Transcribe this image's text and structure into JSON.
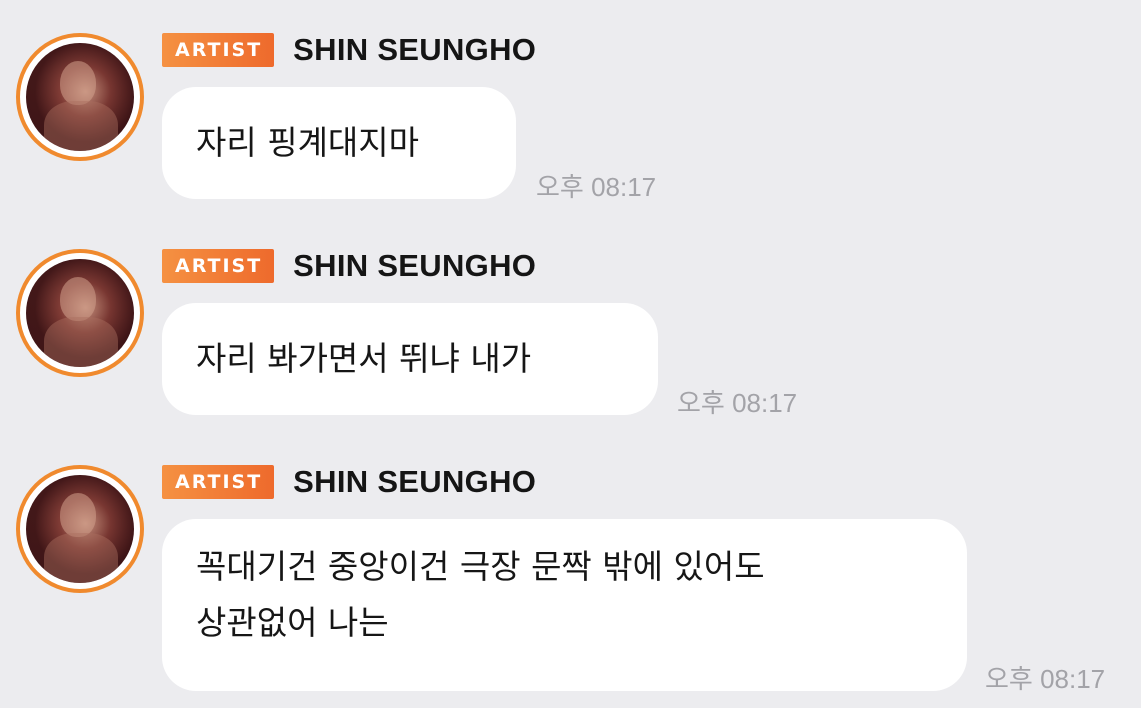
{
  "messages": [
    {
      "badge": "ARTIST",
      "sender": "SHIN SEUNGHO",
      "lines": [
        "자리 핑계대지마"
      ],
      "time": "오후 08:17",
      "avatar": "artist-profile-photo"
    },
    {
      "badge": "ARTIST",
      "sender": "SHIN SEUNGHO",
      "lines": [
        "자리 봐가면서 뛰냐 내가"
      ],
      "time": "오후 08:17",
      "avatar": "artist-profile-photo"
    },
    {
      "badge": "ARTIST",
      "sender": "SHIN SEUNGHO",
      "lines": [
        "꼭대기건 중앙이건 극장 문짝 밖에 있어도",
        "상관없어 나는"
      ],
      "time": "오후 08:17",
      "avatar": "artist-profile-photo"
    }
  ],
  "colors": {
    "background": "#ececef",
    "bubble": "#ffffff",
    "badge_start": "#f59142",
    "badge_end": "#ee6a2c",
    "avatar_ring": "#f08a2e",
    "timestamp": "#a3a3a8",
    "text": "#161616"
  }
}
